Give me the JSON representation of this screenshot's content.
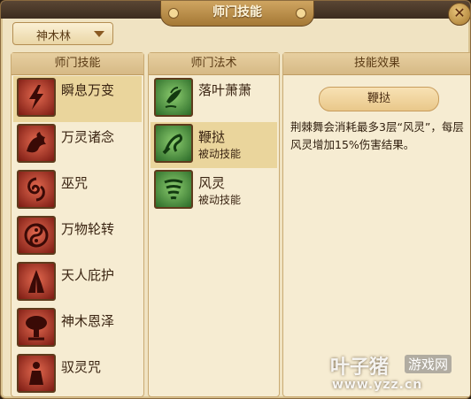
{
  "window": {
    "title": "师门技能",
    "close_glyph": "✕"
  },
  "school_selector": {
    "value": "神木林"
  },
  "skills_panel": {
    "header": "师门技能",
    "items": [
      {
        "name": "瞬息万变",
        "icon": "lightning-icon",
        "selected": true
      },
      {
        "name": "万灵诸念",
        "icon": "beast-icon",
        "selected": false
      },
      {
        "name": "巫咒",
        "icon": "spiral-curse-icon",
        "selected": false
      },
      {
        "name": "万物轮转",
        "icon": "wheel-icon",
        "selected": false
      },
      {
        "name": "天人庇护",
        "icon": "praying-hands-icon",
        "selected": false
      },
      {
        "name": "神木恩泽",
        "icon": "tree-icon",
        "selected": false
      },
      {
        "name": "驭灵咒",
        "icon": "spirit-figure-icon",
        "selected": false
      }
    ]
  },
  "spells_panel": {
    "header": "师门法术",
    "items": [
      {
        "name": "落叶萧萧",
        "sub": "",
        "icon": "falling-leaves-icon",
        "selected": false
      },
      {
        "name": "鞭挞",
        "sub": "被动技能",
        "icon": "whip-icon",
        "selected": true
      },
      {
        "name": "风灵",
        "sub": "被动技能",
        "icon": "wind-spirit-icon",
        "selected": false
      }
    ]
  },
  "effect_panel": {
    "header": "技能效果",
    "title": "鞭挞",
    "description": "荆棘舞会消耗最多3层“风灵”，每层风灵增加15%伤害结果。"
  },
  "watermark": {
    "main": "叶子猪",
    "badge": "游戏网",
    "url": "www.yzz.cn"
  },
  "colors": {
    "panel_bg": "#f6ecd2",
    "header_bg": "#d6b985",
    "selected_row": "#ead59c",
    "skill_icon_red": "#b8322a",
    "spell_icon_green": "#4a9a3e"
  }
}
